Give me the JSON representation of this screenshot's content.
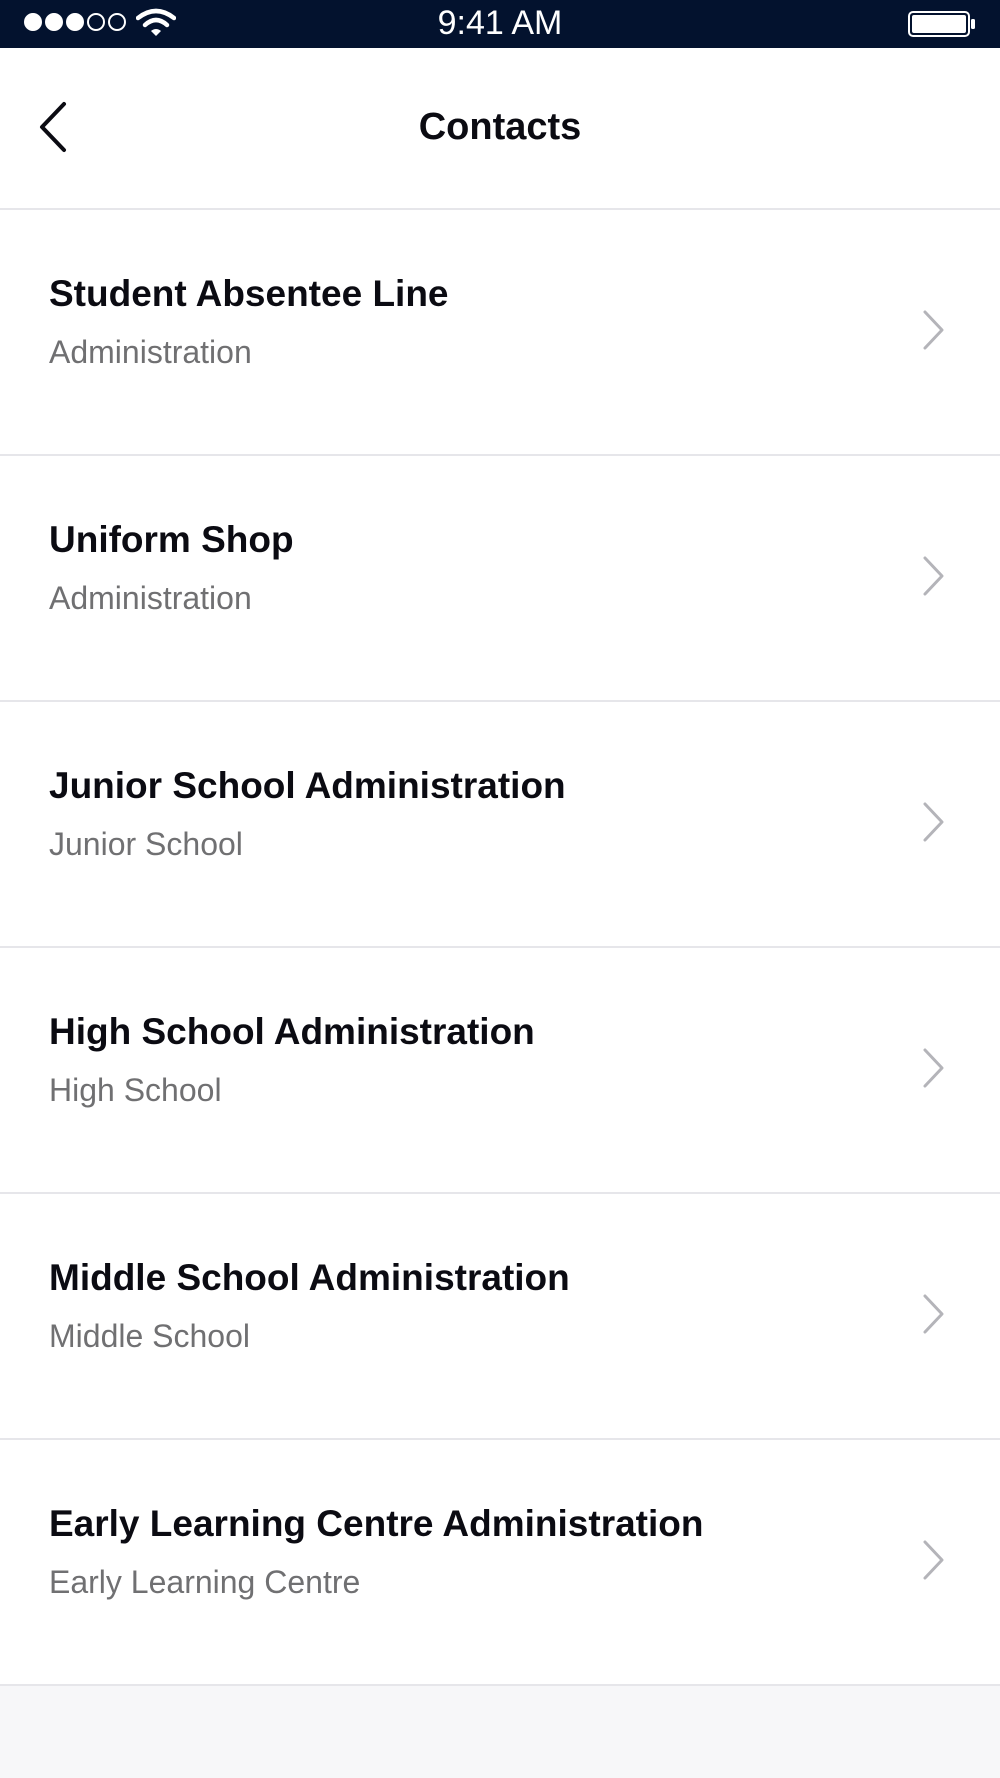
{
  "status_bar": {
    "time": "9:41 AM",
    "signal_bars_filled": 3,
    "signal_bars_total": 5,
    "icons": [
      "signal-dots-icon",
      "wifi-icon",
      "battery-icon"
    ]
  },
  "nav": {
    "title": "Contacts",
    "back_icon": "back-chevron-icon"
  },
  "contacts": [
    {
      "name": "Student Absentee Line",
      "department": "Administration"
    },
    {
      "name": "Uniform Shop",
      "department": "Administration"
    },
    {
      "name": "Junior School Administration",
      "department": "Junior School"
    },
    {
      "name": "High School Administration",
      "department": "High School"
    },
    {
      "name": "Middle School Administration",
      "department": "Middle School"
    },
    {
      "name": "Early Learning Centre Administration",
      "department": "Early Learning Centre"
    }
  ],
  "colors": {
    "status_bar_bg": "#03122e",
    "title_text": "#0b0b12",
    "subtitle_text": "#707072",
    "divider": "#e6e6ea",
    "chevron": "#b4b4b9",
    "page_bg": "#f7f7f9"
  }
}
